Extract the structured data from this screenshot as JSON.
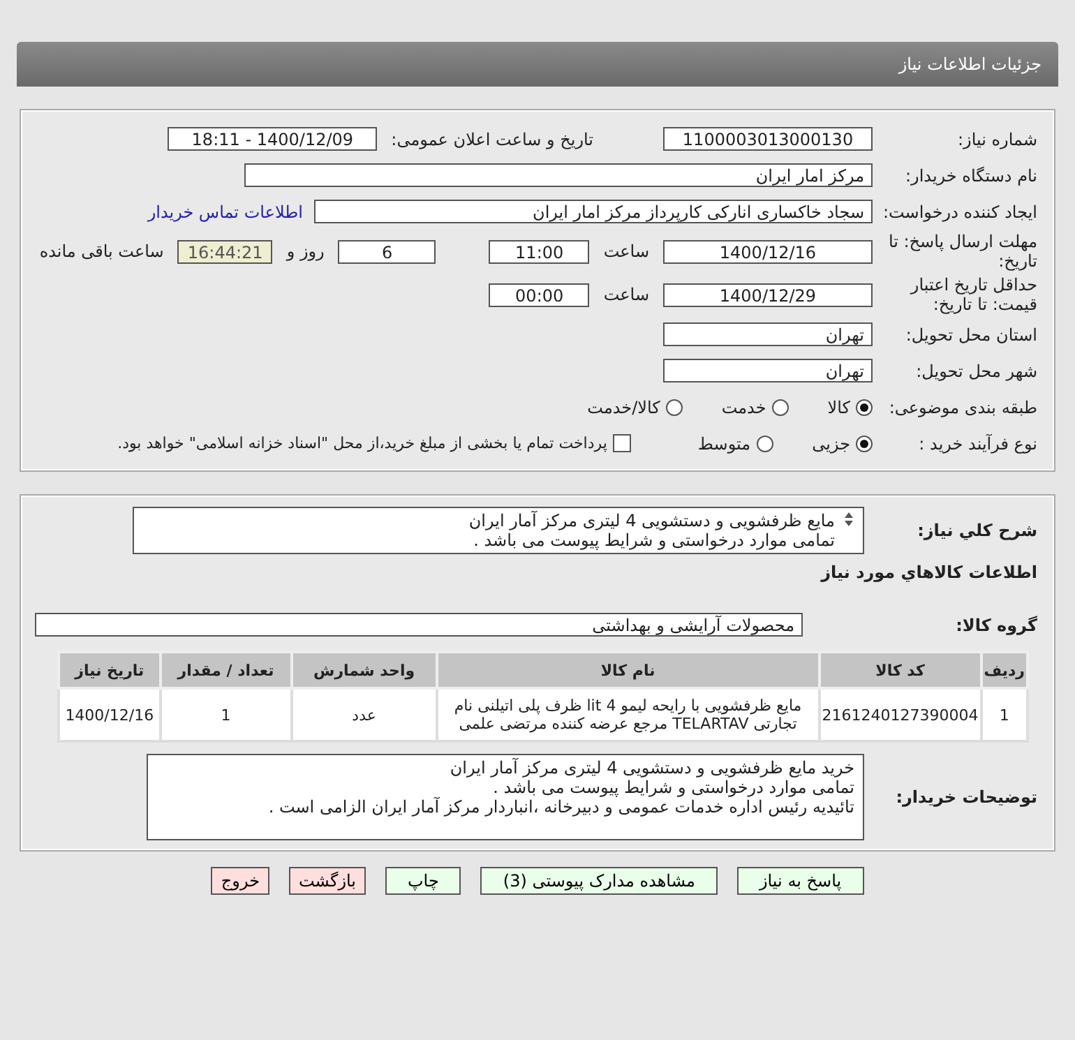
{
  "header": {
    "title": "جزئیات اطلاعات نیاز"
  },
  "need_number": {
    "label": "شماره نیاز:",
    "value": "1100003013000130"
  },
  "announce": {
    "label": "تاریخ و ساعت اعلان عمومی:",
    "value": "1400/12/09 - 18:11"
  },
  "buyer_org": {
    "label": "نام دستگاه خریدار:",
    "value": "مرکز امار ایران"
  },
  "requester": {
    "label": "ایجاد کننده درخواست:",
    "value": "سجاد خاکساری انارکی کارپرداز مرکز امار ایران",
    "link": "اطلاعات تماس خریدار"
  },
  "deadline": {
    "label": "مهلت ارسال پاسخ: تا تاریخ:",
    "date": "1400/12/16",
    "time_label": "ساعت",
    "time": "11:00",
    "days": "6",
    "days_label": "روز و",
    "remaining": "16:44:21",
    "remaining_label": "ساعت باقی مانده"
  },
  "validity": {
    "label": "حداقل تاریخ اعتبار قیمت: تا تاریخ:",
    "date": "1400/12/29",
    "time_label": "ساعت",
    "time": "00:00"
  },
  "province": {
    "label": "استان محل تحویل:",
    "value": "تهران"
  },
  "city": {
    "label": "شهر محل تحویل:",
    "value": "تهران"
  },
  "category": {
    "label": "طبقه بندی موضوعی:",
    "options": [
      {
        "label": "کالا",
        "selected": true
      },
      {
        "label": "خدمت",
        "selected": false
      },
      {
        "label": "کالا/خدمت",
        "selected": false
      }
    ]
  },
  "process": {
    "label": "نوع فرآیند خرید :",
    "options": [
      {
        "label": "جزیی",
        "selected": true
      },
      {
        "label": "متوسط",
        "selected": false
      }
    ],
    "treasury": {
      "label": "پرداخت تمام یا بخشی از مبلغ خرید،از محل \"اسناد خزانه اسلامی\" خواهد بود.",
      "checked": false
    }
  },
  "description": {
    "label": "شرح کلي نياز:",
    "lines": [
      "مایع ظرفشویی و دستشویی 4 لیتری مرکز آمار ایران",
      "تمامی موارد درخواستی و شرایط پیوست می باشد ."
    ]
  },
  "goods_title": "اطلاعات كالاهاي مورد نياز",
  "goods_group": {
    "label": "گروه کالا:",
    "value": "محصولات آرایشی و بهداشتی"
  },
  "table": {
    "columns": [
      "ردیف",
      "کد کالا",
      "نام کالا",
      "واحد شمارش",
      "تعداد / مقدار",
      "تاریخ نیاز"
    ],
    "rows": [
      [
        "1",
        "2161240127390004",
        "مایع ظرفشویی با رایحه لیمو 4 lit ظرف پلی اتیلنی نام تجارتی TELARTAV مرجع عرضه کننده مرتضی علمی",
        "عدد",
        "1",
        "1400/12/16"
      ]
    ]
  },
  "buyer_notes": {
    "label": "توضیحات خریدار:",
    "lines": [
      "خرید مایع ظرفشویی و دستشویی 4 لیتری مرکز آمار ایران",
      "تمامی موارد درخواستی و شرایط پیوست می باشد .",
      "تائیدیه رئیس اداره خدمات عمومی و دبیرخانه ،انباردار مرکز آمار ایران الزامی است ."
    ]
  },
  "buttons": [
    {
      "label": "پاسخ به نیاز",
      "kind": "action"
    },
    {
      "label": "مشاهده مدارک پیوستی (3)",
      "kind": "action"
    },
    {
      "label": "چاپ",
      "kind": "action"
    },
    {
      "label": "بازگشت",
      "kind": "exit"
    },
    {
      "label": "خروج",
      "kind": "exit"
    }
  ]
}
